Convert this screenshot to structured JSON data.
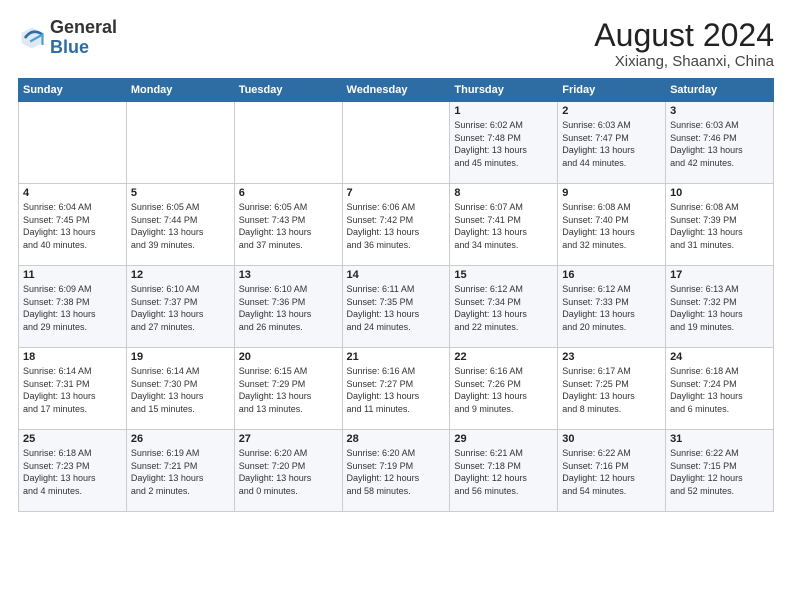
{
  "header": {
    "logo_general": "General",
    "logo_blue": "Blue",
    "month_year": "August 2024",
    "location": "Xixiang, Shaanxi, China"
  },
  "weekdays": [
    "Sunday",
    "Monday",
    "Tuesday",
    "Wednesday",
    "Thursday",
    "Friday",
    "Saturday"
  ],
  "weeks": [
    [
      {
        "day": "",
        "info": ""
      },
      {
        "day": "",
        "info": ""
      },
      {
        "day": "",
        "info": ""
      },
      {
        "day": "",
        "info": ""
      },
      {
        "day": "1",
        "info": "Sunrise: 6:02 AM\nSunset: 7:48 PM\nDaylight: 13 hours\nand 45 minutes."
      },
      {
        "day": "2",
        "info": "Sunrise: 6:03 AM\nSunset: 7:47 PM\nDaylight: 13 hours\nand 44 minutes."
      },
      {
        "day": "3",
        "info": "Sunrise: 6:03 AM\nSunset: 7:46 PM\nDaylight: 13 hours\nand 42 minutes."
      }
    ],
    [
      {
        "day": "4",
        "info": "Sunrise: 6:04 AM\nSunset: 7:45 PM\nDaylight: 13 hours\nand 40 minutes."
      },
      {
        "day": "5",
        "info": "Sunrise: 6:05 AM\nSunset: 7:44 PM\nDaylight: 13 hours\nand 39 minutes."
      },
      {
        "day": "6",
        "info": "Sunrise: 6:05 AM\nSunset: 7:43 PM\nDaylight: 13 hours\nand 37 minutes."
      },
      {
        "day": "7",
        "info": "Sunrise: 6:06 AM\nSunset: 7:42 PM\nDaylight: 13 hours\nand 36 minutes."
      },
      {
        "day": "8",
        "info": "Sunrise: 6:07 AM\nSunset: 7:41 PM\nDaylight: 13 hours\nand 34 minutes."
      },
      {
        "day": "9",
        "info": "Sunrise: 6:08 AM\nSunset: 7:40 PM\nDaylight: 13 hours\nand 32 minutes."
      },
      {
        "day": "10",
        "info": "Sunrise: 6:08 AM\nSunset: 7:39 PM\nDaylight: 13 hours\nand 31 minutes."
      }
    ],
    [
      {
        "day": "11",
        "info": "Sunrise: 6:09 AM\nSunset: 7:38 PM\nDaylight: 13 hours\nand 29 minutes."
      },
      {
        "day": "12",
        "info": "Sunrise: 6:10 AM\nSunset: 7:37 PM\nDaylight: 13 hours\nand 27 minutes."
      },
      {
        "day": "13",
        "info": "Sunrise: 6:10 AM\nSunset: 7:36 PM\nDaylight: 13 hours\nand 26 minutes."
      },
      {
        "day": "14",
        "info": "Sunrise: 6:11 AM\nSunset: 7:35 PM\nDaylight: 13 hours\nand 24 minutes."
      },
      {
        "day": "15",
        "info": "Sunrise: 6:12 AM\nSunset: 7:34 PM\nDaylight: 13 hours\nand 22 minutes."
      },
      {
        "day": "16",
        "info": "Sunrise: 6:12 AM\nSunset: 7:33 PM\nDaylight: 13 hours\nand 20 minutes."
      },
      {
        "day": "17",
        "info": "Sunrise: 6:13 AM\nSunset: 7:32 PM\nDaylight: 13 hours\nand 19 minutes."
      }
    ],
    [
      {
        "day": "18",
        "info": "Sunrise: 6:14 AM\nSunset: 7:31 PM\nDaylight: 13 hours\nand 17 minutes."
      },
      {
        "day": "19",
        "info": "Sunrise: 6:14 AM\nSunset: 7:30 PM\nDaylight: 13 hours\nand 15 minutes."
      },
      {
        "day": "20",
        "info": "Sunrise: 6:15 AM\nSunset: 7:29 PM\nDaylight: 13 hours\nand 13 minutes."
      },
      {
        "day": "21",
        "info": "Sunrise: 6:16 AM\nSunset: 7:27 PM\nDaylight: 13 hours\nand 11 minutes."
      },
      {
        "day": "22",
        "info": "Sunrise: 6:16 AM\nSunset: 7:26 PM\nDaylight: 13 hours\nand 9 minutes."
      },
      {
        "day": "23",
        "info": "Sunrise: 6:17 AM\nSunset: 7:25 PM\nDaylight: 13 hours\nand 8 minutes."
      },
      {
        "day": "24",
        "info": "Sunrise: 6:18 AM\nSunset: 7:24 PM\nDaylight: 13 hours\nand 6 minutes."
      }
    ],
    [
      {
        "day": "25",
        "info": "Sunrise: 6:18 AM\nSunset: 7:23 PM\nDaylight: 13 hours\nand 4 minutes."
      },
      {
        "day": "26",
        "info": "Sunrise: 6:19 AM\nSunset: 7:21 PM\nDaylight: 13 hours\nand 2 minutes."
      },
      {
        "day": "27",
        "info": "Sunrise: 6:20 AM\nSunset: 7:20 PM\nDaylight: 13 hours\nand 0 minutes."
      },
      {
        "day": "28",
        "info": "Sunrise: 6:20 AM\nSunset: 7:19 PM\nDaylight: 12 hours\nand 58 minutes."
      },
      {
        "day": "29",
        "info": "Sunrise: 6:21 AM\nSunset: 7:18 PM\nDaylight: 12 hours\nand 56 minutes."
      },
      {
        "day": "30",
        "info": "Sunrise: 6:22 AM\nSunset: 7:16 PM\nDaylight: 12 hours\nand 54 minutes."
      },
      {
        "day": "31",
        "info": "Sunrise: 6:22 AM\nSunset: 7:15 PM\nDaylight: 12 hours\nand 52 minutes."
      }
    ]
  ]
}
